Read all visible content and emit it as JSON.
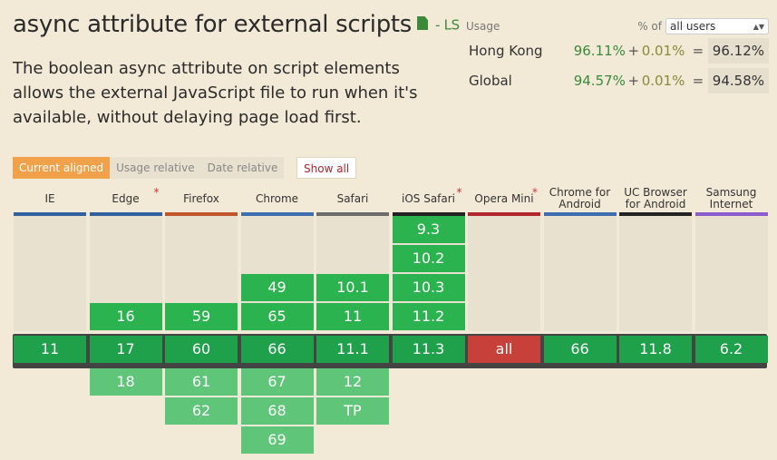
{
  "header": {
    "title": "async attribute for external scripts",
    "ls_label": "- LS",
    "description": "The boolean async attribute on script elements allows the external JavaScript file to run when it's available, without delaying page load first."
  },
  "usage": {
    "label": "Usage",
    "pct_of": "% of",
    "selector_value": "all users",
    "rows": [
      {
        "region": "Hong Kong",
        "pct": "96.11%",
        "plus": "+",
        "partial": "0.01%",
        "eq": "=",
        "total": "96.12%"
      },
      {
        "region": "Global",
        "pct": "94.57%",
        "plus": "+",
        "partial": "0.01%",
        "eq": "=",
        "total": "94.58%"
      }
    ]
  },
  "views": {
    "current": "Current aligned",
    "usage_relative": "Usage relative",
    "date_relative": "Date relative",
    "show_all": "Show all"
  },
  "colors": {
    "supported": "#2bb34f",
    "current": "#1ea14a",
    "future": "#5fc579",
    "unsupported": "#c7403a"
  },
  "browsers": [
    {
      "name": "IE",
      "star": "",
      "bar": "#30609e",
      "past": [],
      "current": "11",
      "future": []
    },
    {
      "name": "Edge",
      "star": "*",
      "bar": "#30609e",
      "past": [
        "16"
      ],
      "current": "17",
      "future": [
        "18"
      ]
    },
    {
      "name": "Firefox",
      "star": "",
      "bar": "#c0542b",
      "past": [
        "59"
      ],
      "current": "60",
      "future": [
        "61",
        "62"
      ]
    },
    {
      "name": "Chrome",
      "star": "",
      "bar": "#3e6eb0",
      "past": [
        "49",
        "65"
      ],
      "current": "66",
      "future": [
        "67",
        "68",
        "69"
      ]
    },
    {
      "name": "Safari",
      "star": "",
      "bar": "#6c6c6c",
      "past": [
        "10.1",
        "11"
      ],
      "current": "11.1",
      "future": [
        "12",
        "TP"
      ]
    },
    {
      "name": "iOS Safari",
      "star": "*",
      "bar": "#222222",
      "past": [
        "9.3",
        "10.2",
        "10.3",
        "11.2"
      ],
      "current": "11.3",
      "future": []
    },
    {
      "name": "Opera Mini",
      "star": "*",
      "bar": "#b3262d",
      "past": [],
      "current": "all",
      "future": [],
      "unsupported": true
    },
    {
      "name": "Chrome for Android",
      "star": "",
      "bar": "#3e6eb0",
      "past": [],
      "current": "66",
      "future": []
    },
    {
      "name": "UC Browser for Android",
      "star": "",
      "bar": "#222222",
      "past": [],
      "current": "11.8",
      "future": []
    },
    {
      "name": "Samsung Internet",
      "star": "",
      "bar": "#8e5bd0",
      "past": [],
      "current": "6.2",
      "future": []
    }
  ]
}
